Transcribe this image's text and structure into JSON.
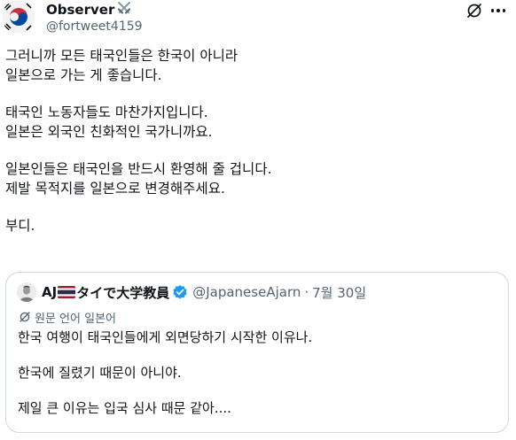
{
  "author": {
    "display_name": "Observer",
    "handle": "@fortweet4159",
    "name_emoji": "crossed-swords-icon"
  },
  "header_actions": {
    "translate_icon": "translate-icon",
    "more_icon": "more-icon"
  },
  "tweet": {
    "lines": [
      "그러니까 모든 태국인들은 한국이 아니라",
      "일본으로 가는 게 좋습니다.",
      "",
      "태국인 노동자들도 마찬가지입니다.",
      "일본은 외국인 친화적인 국가니까요.",
      "",
      "일본인들은 태국인을 반드시 환영해 줄 겁니다.",
      "제발 목적지를 일본으로 변경해주세요.",
      "",
      "부디."
    ]
  },
  "quote": {
    "name_prefix": "AJ",
    "name_suffix": "タイで大学教員",
    "flag": "thailand-flag-icon",
    "handle": "@JapaneseAjarn",
    "separator": "·",
    "date": "7월 30일",
    "translation_label": "원문 언어 일본어",
    "lines": [
      "한국 여행이 태국인들에게 외면당하기 시작한 이유나.",
      "",
      "한국에 질렸기 때문이 아니야.",
      "",
      "제일 큰 이유는 입국 심사 때문 같아...."
    ]
  },
  "colors": {
    "text": "#0f1419",
    "secondary": "#536471",
    "border": "#cfd9de",
    "verified": "#1d9bf0"
  }
}
